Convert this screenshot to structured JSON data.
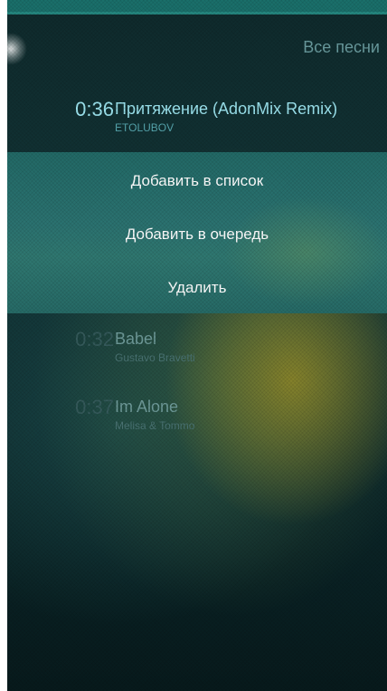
{
  "header": {
    "title": "Все песни"
  },
  "active_song": {
    "time": "0:36",
    "title": "Притяжение (AdonMix Remix)",
    "artist": "ETOLUBOV"
  },
  "context_menu": {
    "items": [
      {
        "label": "Добавить в список"
      },
      {
        "label": "Добавить в очередь"
      },
      {
        "label": "Удалить"
      }
    ]
  },
  "songs": [
    {
      "time": "0:32",
      "title": "Babel",
      "artist": "Gustavo Bravetti"
    },
    {
      "time": "0:37",
      "title": "Im Alone",
      "artist": "Melisa & Tommo"
    }
  ],
  "colors": {
    "accent": "#9ce4ef",
    "menu_background": "#2b7270",
    "top_bar": "#1a6f6a"
  }
}
